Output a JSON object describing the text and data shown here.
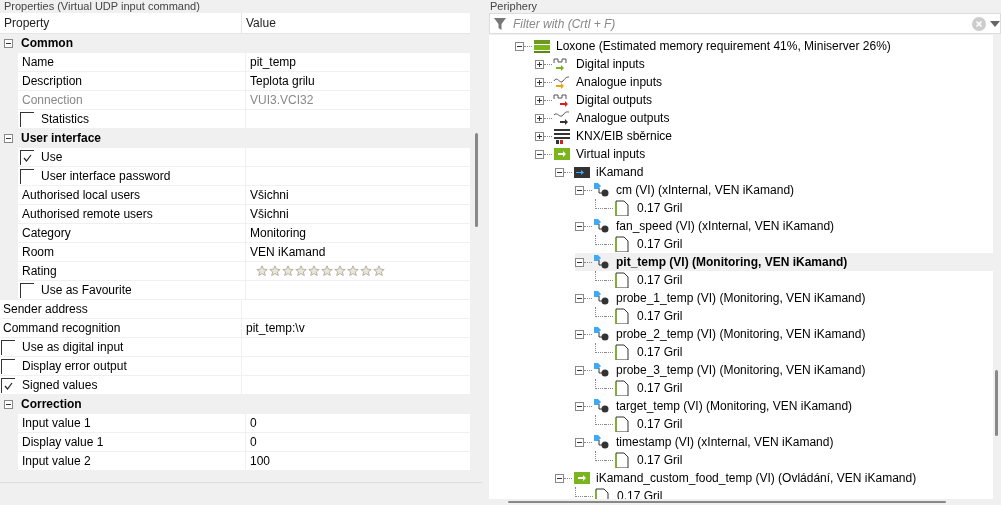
{
  "properties": {
    "title": "Properties (Virtual UDP input command)",
    "columns": [
      "Property",
      "Value"
    ],
    "rows": [
      {
        "kind": "group",
        "label": "Common",
        "expanded": true,
        "children": [
          {
            "kind": "prop",
            "label": "Name",
            "value": "pit_temp"
          },
          {
            "kind": "prop",
            "label": "Description",
            "value": "Teplota grilu"
          },
          {
            "kind": "prop",
            "label": "Connection",
            "value": "VUI3.VCI32",
            "disabled": true
          },
          {
            "kind": "check",
            "label": "Statistics",
            "checked": false
          }
        ]
      },
      {
        "kind": "group",
        "label": "User interface",
        "expanded": true,
        "children": [
          {
            "kind": "check",
            "label": "Use",
            "checked": true
          },
          {
            "kind": "check",
            "label": "User interface password",
            "checked": false
          },
          {
            "kind": "prop",
            "label": "Authorised local users",
            "value": "Všichni"
          },
          {
            "kind": "prop",
            "label": "Authorised remote users",
            "value": "Všichni"
          },
          {
            "kind": "prop",
            "label": "Category",
            "value": "Monitoring"
          },
          {
            "kind": "prop",
            "label": "Room",
            "value": "VEN iKamand"
          },
          {
            "kind": "rating",
            "label": "Rating",
            "stars": 0
          },
          {
            "kind": "check",
            "label": "Use as Favourite",
            "checked": false
          }
        ]
      },
      {
        "kind": "prop",
        "label": "Sender address"
      },
      {
        "kind": "prop",
        "label": "Command recognition",
        "value": "pit_temp:\\v"
      },
      {
        "kind": "check",
        "label": "Use as digital input",
        "checked": false
      },
      {
        "kind": "check",
        "label": "Display error output",
        "checked": false
      },
      {
        "kind": "check",
        "label": "Signed values",
        "checked": true
      },
      {
        "kind": "group",
        "label": "Correction",
        "expanded": true,
        "children": [
          {
            "kind": "prop",
            "label": "Input value 1",
            "value": "0"
          },
          {
            "kind": "prop",
            "label": "Display value 1",
            "value": "0"
          },
          {
            "kind": "prop",
            "label": "Input value 2",
            "value": "100"
          }
        ]
      }
    ]
  },
  "periphery": {
    "title": "Periphery",
    "filter": {
      "placeholder": "Filter with (Crtl + F)"
    },
    "tree": [
      {
        "kind": "miniserver",
        "label": "Loxone (Estimated memory requirement 41%, Miniserver 26%)",
        "expanded": true,
        "selected": false,
        "children": [
          {
            "kind": "digital-input",
            "label": "Digital inputs",
            "expanded": false,
            "selected": false
          },
          {
            "kind": "analog-input",
            "label": "Analogue inputs",
            "expanded": false,
            "selected": false
          },
          {
            "kind": "digital-output",
            "label": "Digital outputs",
            "expanded": false,
            "selected": false
          },
          {
            "kind": "analog-output",
            "label": "Analogue outputs",
            "expanded": false,
            "selected": false
          },
          {
            "kind": "bus",
            "label": "KNX/EIB sběrnice",
            "expanded": false,
            "selected": false
          },
          {
            "kind": "virtual-inputs",
            "label": "Virtual inputs",
            "expanded": true,
            "selected": false,
            "children": [
              {
                "kind": "device",
                "label": "iKamand",
                "expanded": true,
                "selected": false,
                "children": [
                  {
                    "kind": "command",
                    "label": "cm (VI) (xInternal, VEN iKamand)",
                    "expanded": true,
                    "selected": false,
                    "children": [
                      {
                        "kind": "page",
                        "label": "0.17 Gril",
                        "selected": false
                      }
                    ]
                  },
                  {
                    "kind": "command",
                    "label": "fan_speed (VI) (xInternal, VEN iKamand)",
                    "expanded": true,
                    "selected": false,
                    "children": [
                      {
                        "kind": "page",
                        "label": "0.17 Gril",
                        "selected": false
                      }
                    ]
                  },
                  {
                    "kind": "command",
                    "label": "pit_temp (VI) (Monitoring, VEN iKamand)",
                    "expanded": true,
                    "selected": true,
                    "children": [
                      {
                        "kind": "page",
                        "label": "0.17 Gril",
                        "selected": false
                      }
                    ]
                  },
                  {
                    "kind": "command",
                    "label": "probe_1_temp (VI) (Monitoring, VEN iKamand)",
                    "expanded": true,
                    "selected": false,
                    "children": [
                      {
                        "kind": "page",
                        "label": "0.17 Gril",
                        "selected": false
                      }
                    ]
                  },
                  {
                    "kind": "command",
                    "label": "probe_2_temp (VI) (Monitoring, VEN iKamand)",
                    "expanded": true,
                    "selected": false,
                    "children": [
                      {
                        "kind": "page",
                        "label": "0.17 Gril",
                        "selected": false
                      }
                    ]
                  },
                  {
                    "kind": "command",
                    "label": "probe_3_temp (VI) (Monitoring, VEN iKamand)",
                    "expanded": true,
                    "selected": false,
                    "children": [
                      {
                        "kind": "page",
                        "label": "0.17 Gril",
                        "selected": false
                      }
                    ]
                  },
                  {
                    "kind": "command",
                    "label": "target_temp (VI) (Monitoring, VEN iKamand)",
                    "expanded": true,
                    "selected": false,
                    "children": [
                      {
                        "kind": "page",
                        "label": "0.17 Gril",
                        "selected": false
                      }
                    ]
                  },
                  {
                    "kind": "command",
                    "label": "timestamp (VI) (xInternal, VEN iKamand)",
                    "expanded": true,
                    "selected": false,
                    "children": [
                      {
                        "kind": "page",
                        "label": "0.17 Gril",
                        "selected": false
                      }
                    ]
                  }
                ]
              },
              {
                "kind": "virtual-input",
                "label": "iKamand_custom_food_temp (VI) (Ovládání, VEN iKamand)",
                "expanded": true,
                "selected": false,
                "children": [
                  {
                    "kind": "page",
                    "label": "0.17 Gril",
                    "selected": false
                  }
                ]
              }
            ]
          }
        ]
      }
    ]
  }
}
